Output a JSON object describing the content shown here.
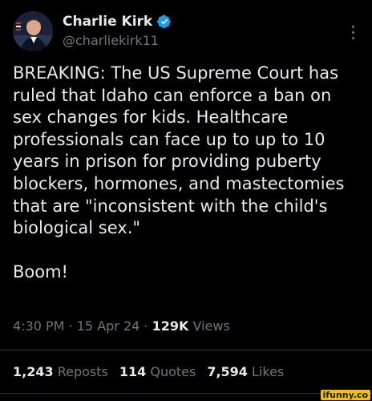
{
  "author": {
    "display_name": "Charlie Kirk",
    "handle": "@charliekirk11",
    "verified": true,
    "verified_color": "#1d9bf0"
  },
  "tweet": {
    "text": "BREAKING: The US Supreme Court has ruled that Idaho can enforce a ban on sex changes for kids. Healthcare professionals can face up to up to 10 years in prison for providing puberty blockers, hormones, and mastectomies that are \"inconsistent with the child's biological sex.\"",
    "text_secondary": "Boom!"
  },
  "meta": {
    "time": "4:30 PM",
    "separator": "·",
    "date": "15 Apr 24",
    "views_count": "129K",
    "views_label": "Views"
  },
  "stats": {
    "reposts_count": "1,243",
    "reposts_label": "Reposts",
    "quotes_count": "114",
    "quotes_label": "Quotes",
    "likes_count": "7,594",
    "likes_label": "Likes"
  },
  "watermark": {
    "text": "ifunny.co"
  },
  "icons": {
    "verified": "verified-badge-icon",
    "more": "more-options-icon"
  },
  "colors": {
    "background": "#000000",
    "primary_text": "#e7e9ea",
    "secondary_text": "#71767b",
    "divider": "#2f3336"
  }
}
